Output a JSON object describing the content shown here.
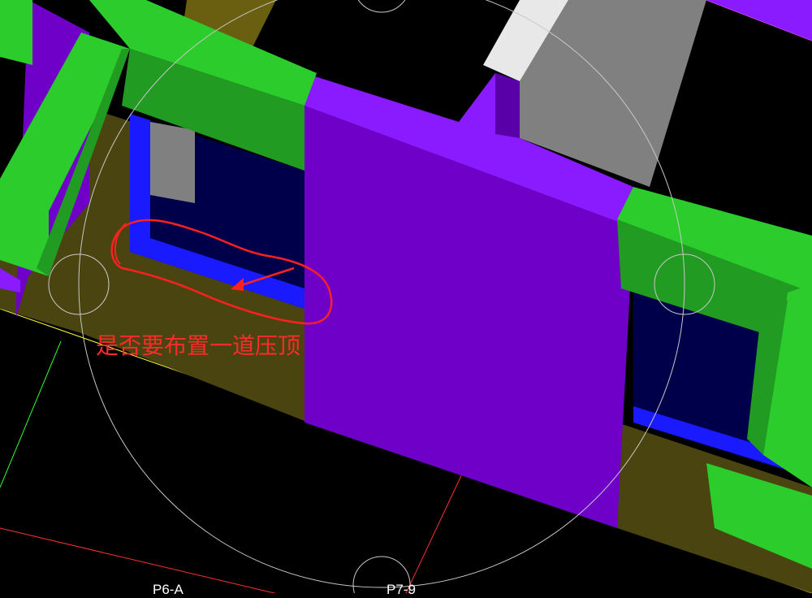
{
  "viewport": {
    "background": "#000000",
    "annotation": {
      "text": "是否要布置一道压顶",
      "color": "#ff2a2a",
      "shape": "freehand-outline-with-arrow"
    },
    "axis_labels": [
      "P6-A",
      "P7-9"
    ],
    "colors": {
      "beam": "#2bcc2b",
      "wall": "#6e00c8",
      "wall_top": "#8a1aff",
      "slab": "#4a4410",
      "window_frame": "#1a1aff",
      "glass": "#00004a",
      "column": "#808080"
    },
    "icons": [
      "orbit-circle-icon",
      "axis-grid-lines"
    ]
  }
}
